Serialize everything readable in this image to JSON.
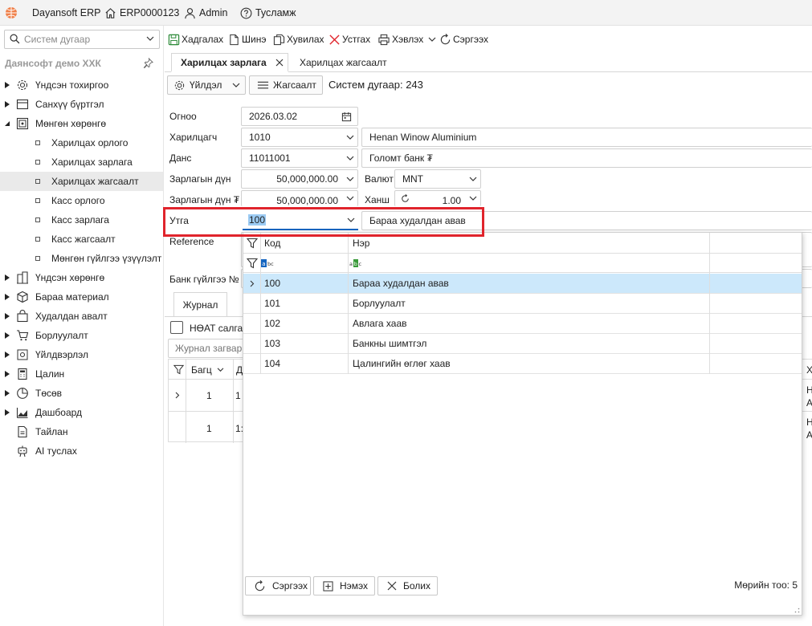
{
  "titlebar": {
    "app_name": "Dayansoft ERP",
    "db_name": "ERP0000123",
    "user": "Admin",
    "help": "Тусламж"
  },
  "sidebar": {
    "search_placeholder": "Систем дугаар",
    "company": "Даянсофт демо ХХК",
    "items": [
      {
        "label": "Үндсэн тохиргоо"
      },
      {
        "label": "Санхүү бүртгэл"
      },
      {
        "label": "Мөнгөн хөрөнгө"
      },
      {
        "label": "Харилцах орлого"
      },
      {
        "label": "Харилцах зарлага"
      },
      {
        "label": "Харилцах жагсаалт"
      },
      {
        "label": "Касс орлого"
      },
      {
        "label": "Касс зарлага"
      },
      {
        "label": "Касс жагсаалт"
      },
      {
        "label": "Мөнгөн гүйлгээ үзүүлэлт"
      },
      {
        "label": "Үндсэн хөрөнгө"
      },
      {
        "label": "Бараа материал"
      },
      {
        "label": "Худалдан авалт"
      },
      {
        "label": "Борлуулалт"
      },
      {
        "label": "Үйлдвэрлэл"
      },
      {
        "label": "Цалин"
      },
      {
        "label": "Төсөв"
      },
      {
        "label": "Дашбоард"
      },
      {
        "label": "Тайлан"
      },
      {
        "label": "AI туслах"
      }
    ]
  },
  "toolbar": {
    "save": "Хадгалах",
    "new": "Шинэ",
    "copy": "Хувилах",
    "delete": "Устгах",
    "print": "Хэвлэх",
    "refresh": "Сэргээх"
  },
  "tabs": {
    "active": "Харилцах зарлага",
    "other": "Харилцах жагсаалт"
  },
  "form": {
    "action_btn": "Үйлдэл",
    "list_btn": "Жагсаалт",
    "system_number": "Систем дугаар: 243",
    "date_label": "Огноо",
    "date_value": "2026.03.02",
    "partner_label": "Харилцагч",
    "partner_code": "1010",
    "partner_name": "Henan Winow Aluminium",
    "account_label": "Данс",
    "account_code": "11011001",
    "account_name": "Голомт банк ₮",
    "amount_label": "Зарлагын дүн",
    "amount_value": "50,000,000.00",
    "currency_label": "Валют",
    "currency_value": "MNT",
    "amount_mnt_label": "Зарлагын дүн ₮",
    "amount_mnt_value": "50,000,000.00",
    "rate_label": "Ханш",
    "rate_value": "1.00",
    "purpose_label": "Утга",
    "purpose_code": "100",
    "purpose_name": "Бараа худалдан авав",
    "reference_label": "Reference",
    "bank_tx_label": "Банк гүйлгээ №",
    "journal_tab": "Журнал",
    "vat_label": "НӨАТ салгах",
    "journal_placeholder": "Журнал загвар",
    "grid_col_bagts": "Багц",
    "grid_col_d": "Д",
    "grid_col_x": "Х",
    "grid_rows": [
      {
        "bagts": "1",
        "d": "1",
        "x": "Н А"
      },
      {
        "bagts": "1",
        "d": "1:",
        "x": "Н А"
      }
    ]
  },
  "popup": {
    "col_code": "Код",
    "col_name": "Нэр",
    "rows": [
      {
        "code": "100",
        "name": "Бараа худалдан авав"
      },
      {
        "code": "101",
        "name": "Борлуулалт"
      },
      {
        "code": "102",
        "name": "Авлага хаав"
      },
      {
        "code": "103",
        "name": "Банкны шимтгэл"
      },
      {
        "code": "104",
        "name": "Цалингийн өглөг хаав"
      }
    ],
    "refresh_btn": "Сэргээх",
    "add_btn": "Нэмэх",
    "cancel_btn": "Болих",
    "row_count": "Мөрийн тоо: 5"
  },
  "colors": {
    "accent_red": "#e0242c",
    "selected_row": "#cce8fb",
    "text_selection": "#9ccbf3"
  }
}
